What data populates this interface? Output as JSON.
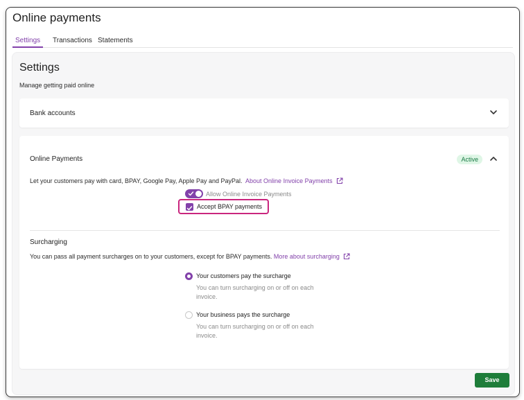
{
  "page": {
    "title": "Online payments"
  },
  "tabs": [
    {
      "label": "Settings",
      "active": true
    },
    {
      "label": "Transactions",
      "active": false
    },
    {
      "label": "Statements",
      "active": false
    }
  ],
  "settings": {
    "title": "Settings",
    "subtitle": "Manage getting paid online"
  },
  "bank_accounts": {
    "title": "Bank accounts",
    "expanded": false
  },
  "online_payments": {
    "title": "Online Payments",
    "badge": "Active",
    "expanded": true,
    "description": "Let your customers pay with card, BPAY, Google Pay, Apple Pay and PayPal.",
    "link": "About Online Invoice Payments",
    "allow_toggle": {
      "label": "Allow Online Invoice Payments",
      "on": true
    },
    "bpay_checkbox": {
      "label": "Accept BPAY payments",
      "checked": true
    }
  },
  "surcharging": {
    "title": "Surcharging",
    "description": "You can pass all payment surcharges on to your customers, except for BPAY payments.",
    "link": "More about surcharging",
    "options": [
      {
        "label": "Your customers pay the surcharge",
        "help": "You can turn surcharging on or off on each invoice.",
        "selected": true
      },
      {
        "label": "Your business pays the surcharge",
        "help": "You can turn surcharging on or off on each invoice.",
        "selected": false
      }
    ]
  },
  "footer": {
    "save_label": "Save"
  },
  "colors": {
    "accent": "#8241aa",
    "save": "#1e7d3a",
    "badge_bg": "#dff6e6",
    "highlight": "#c9257e"
  },
  "icons": [
    "chevron-down-icon",
    "chevron-up-icon",
    "external-link-icon",
    "checkmark-icon"
  ]
}
